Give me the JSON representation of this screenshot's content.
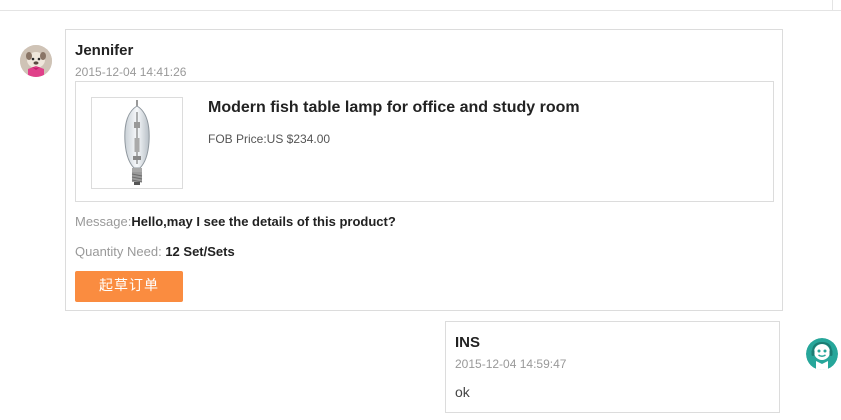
{
  "messages": [
    {
      "sender": "Jennifer",
      "timestamp": "2015-12-04 14:41:26",
      "product": {
        "title": "Modern fish table lamp for office and study room",
        "price": "FOB Price:US $234.00",
        "image_icon": "light-bulb-image"
      },
      "message_label": "Message:",
      "message_value": "Hello,may I see the details of this product?",
      "quantity_label": "Quantity Need: ",
      "quantity_value": "12 Set/Sets",
      "button_label": "起草订单"
    },
    {
      "sender": "INS",
      "timestamp": "2015-12-04 14:59:47",
      "text": "ok"
    }
  ],
  "colors": {
    "accent_button": "#fa8c40",
    "border": "#dcdcdc",
    "muted_text": "#999999",
    "support_icon": "#26a69a"
  },
  "icons": {
    "avatar": "avatar-image",
    "support": "customer-service-icon"
  }
}
